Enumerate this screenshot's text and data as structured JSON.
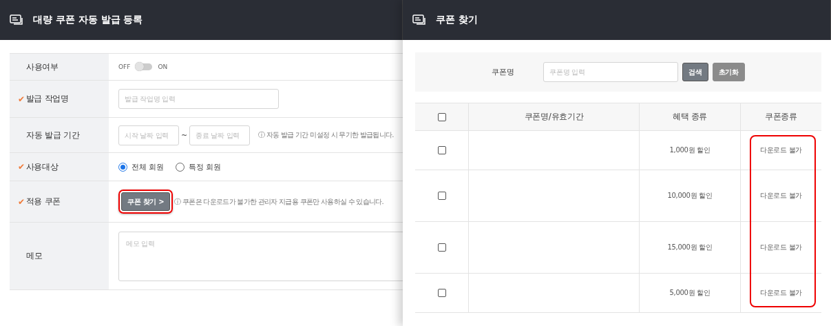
{
  "left_panel": {
    "title": "대량 쿠폰 자동 발급 등록",
    "rows": [
      {
        "kind": "toggle",
        "label": "사용여부",
        "off_label": "OFF",
        "on_label": "ON",
        "on": false
      },
      {
        "kind": "text",
        "label": "발급 작업명",
        "required_mark": "✔",
        "placeholder": "발급 작업명 입력"
      },
      {
        "kind": "dates",
        "label": "자동 발급 기간",
        "start_placeholder": "시작 날짜 입력",
        "separator": "~",
        "end_placeholder": "종료 날짜 입력",
        "hint": "ⓘ 자동 발급 기간 미설정 시 무기한 발급됩니다."
      },
      {
        "kind": "radio",
        "label": "사용대상",
        "required_mark": "✔",
        "options": [
          {
            "label": "전체 회원",
            "selected": true
          },
          {
            "label": "특정 회원",
            "selected": false
          }
        ]
      },
      {
        "kind": "button",
        "label": "적용 쿠폰",
        "required_mark": "✔",
        "button": "쿠폰 찾기 >",
        "highlighted": true,
        "hint": "ⓘ 쿠폰은 다운로드가 불가한 관리자 지급용 쿠폰만 사용하실 수 있습니다."
      },
      {
        "kind": "memo",
        "label": "메모",
        "placeholder": "메모 입력"
      }
    ]
  },
  "right_panel": {
    "title": "쿠폰 찾기",
    "search": {
      "label": "쿠폰명",
      "placeholder": "쿠폰명 입력",
      "buttons": [
        {
          "label": "검색",
          "kind": "primary"
        },
        {
          "label": "초기화",
          "kind": "secondary"
        }
      ]
    },
    "table": {
      "columns": [
        {
          "highlighted": false
        },
        {
          "label": "쿠폰명/유효기간",
          "highlighted": false
        },
        {
          "label": "혜택 종류",
          "highlighted": false
        },
        {
          "label": "쿠폰종류",
          "highlighted": true
        }
      ],
      "header_checked": false,
      "rows": [
        {
          "checked": false,
          "benefit": "1,000원 할인",
          "type": "다운로드 불가"
        },
        {
          "checked": false,
          "benefit": "10,000원 할인",
          "type": "다운로드 불가"
        },
        {
          "checked": false,
          "benefit": "15,000원 할인",
          "type": "다운로드 불가"
        },
        {
          "checked": false,
          "benefit": "5,000원 할인",
          "type": "다운로드 불가"
        }
      ]
    }
  }
}
